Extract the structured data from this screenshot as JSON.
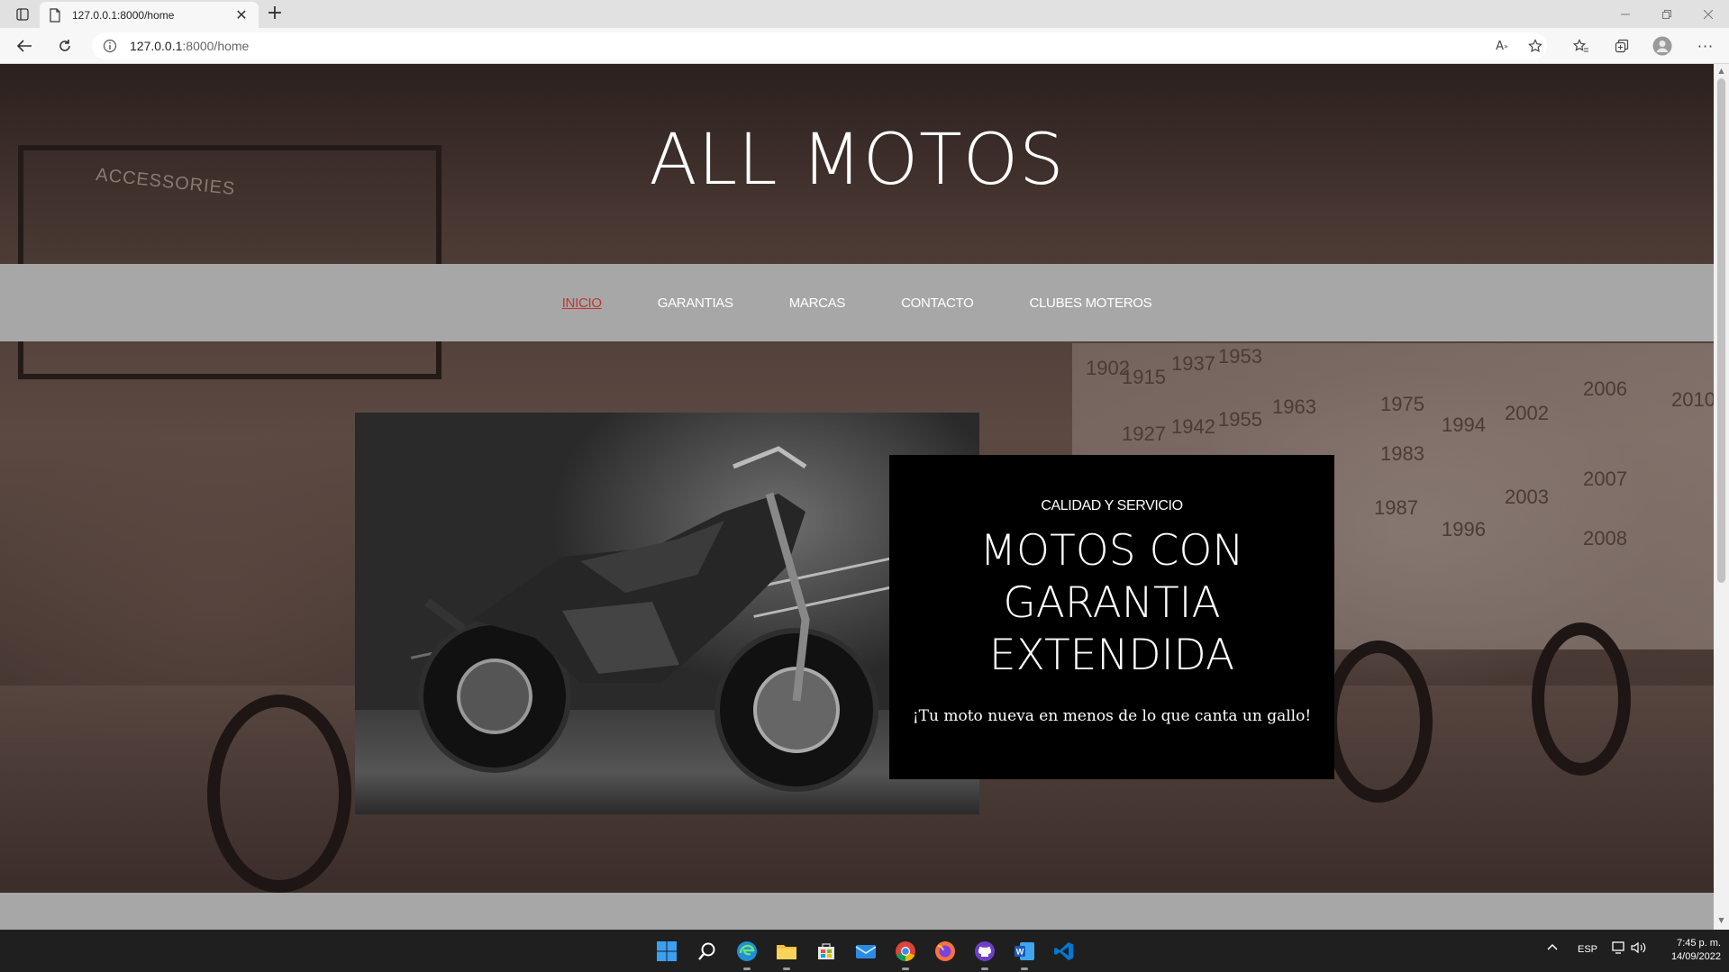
{
  "browser": {
    "tab_title": "127.0.0.1:8000/home",
    "url_host": "127.0.0.1",
    "url_rest": ":8000/home"
  },
  "page": {
    "site_title": "ALL MOTOS",
    "nav": [
      {
        "label": "INICIO",
        "active": true
      },
      {
        "label": "GARANTIAS",
        "active": false
      },
      {
        "label": "MARCAS",
        "active": false
      },
      {
        "label": "CONTACTO",
        "active": false
      },
      {
        "label": "CLUBES MOTEROS",
        "active": false
      }
    ],
    "card": {
      "eyebrow": "CALIDAD Y SERVICIO",
      "headline_line1": "MOTOS CON",
      "headline_line2": "GARANTIA",
      "headline_line3": "EXTENDIDA",
      "tagline": "¡Tu moto nueva en menos de lo que canta un gallo!"
    },
    "background_sign": "ACCESSORIES",
    "background_years": [
      "1902",
      "1915",
      "1937",
      "1953",
      "1963",
      "1975",
      "1994",
      "2002",
      "2006",
      "2010",
      "1942",
      "1955",
      "1983",
      "2003",
      "2007",
      "2008",
      "1927",
      "1987",
      "1996"
    ],
    "accent_color": "#c0392b",
    "nav_bar_color": "#a7a7a7"
  },
  "taskbar": {
    "language": "ESP",
    "time": "7:45 p. m.",
    "date": "14/09/2022",
    "icons": [
      "windows-start-icon",
      "search-icon",
      "edge-icon",
      "file-explorer-icon",
      "store-icon",
      "mail-icon",
      "chrome-icon",
      "firefox-icon",
      "github-icon",
      "word-icon",
      "vscode-icon"
    ]
  }
}
